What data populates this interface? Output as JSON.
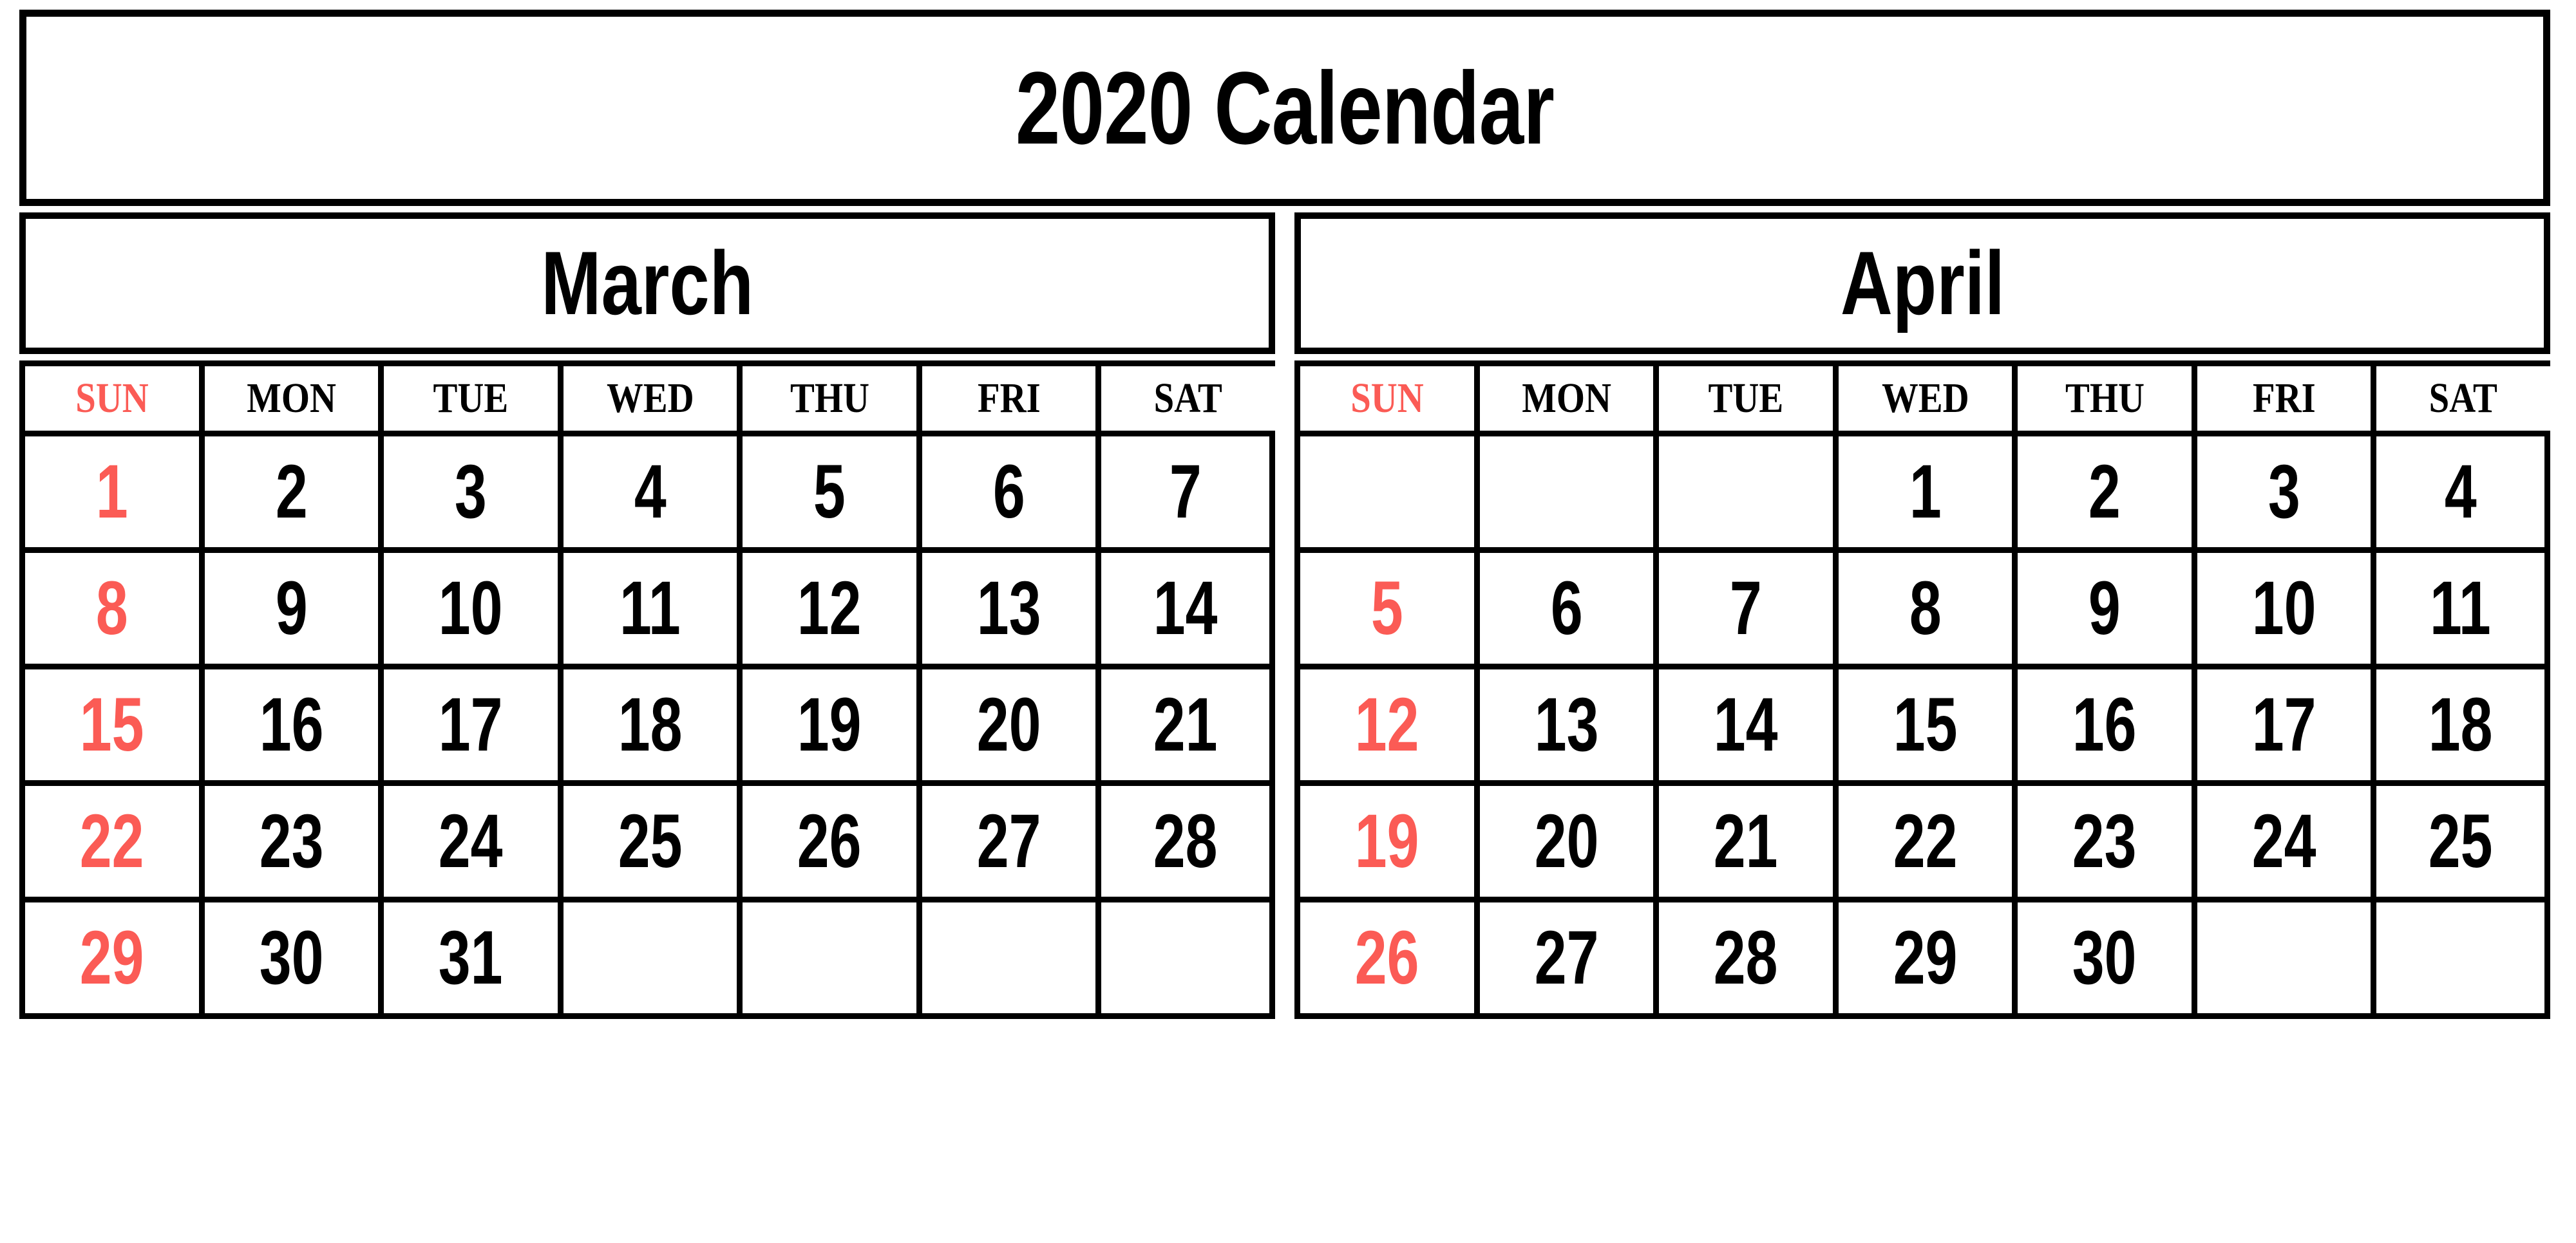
{
  "title": "2020 Calendar",
  "colors": {
    "sunday": "#fb5b55",
    "text": "#000000",
    "border": "#000000",
    "background": "#ffffff"
  },
  "weekday_headers": [
    "SUN",
    "MON",
    "TUE",
    "WED",
    "THU",
    "FRI",
    "SAT"
  ],
  "months": [
    {
      "name": "March",
      "year": "2020",
      "weeks": [
        [
          "1",
          "2",
          "3",
          "4",
          "5",
          "6",
          "7"
        ],
        [
          "8",
          "9",
          "10",
          "11",
          "12",
          "13",
          "14"
        ],
        [
          "15",
          "16",
          "17",
          "18",
          "19",
          "20",
          "21"
        ],
        [
          "22",
          "23",
          "24",
          "25",
          "26",
          "27",
          "28"
        ],
        [
          "29",
          "30",
          "31",
          "",
          "",
          "",
          ""
        ]
      ]
    },
    {
      "name": "April",
      "year": "2020",
      "weeks": [
        [
          "",
          "",
          "",
          "1",
          "2",
          "3",
          "4"
        ],
        [
          "5",
          "6",
          "7",
          "8",
          "9",
          "10",
          "11"
        ],
        [
          "12",
          "13",
          "14",
          "15",
          "16",
          "17",
          "18"
        ],
        [
          "19",
          "20",
          "21",
          "22",
          "23",
          "24",
          "25"
        ],
        [
          "26",
          "27",
          "28",
          "29",
          "30",
          "",
          ""
        ]
      ]
    }
  ]
}
